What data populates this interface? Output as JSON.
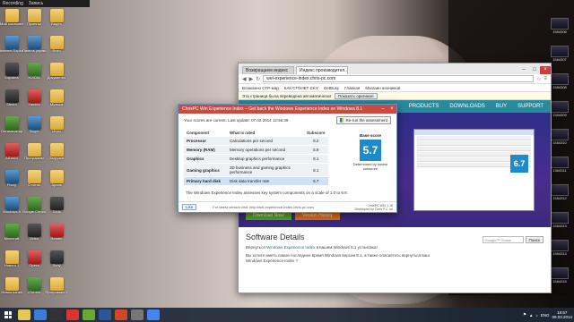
{
  "topbar": {
    "left": "Recording",
    "right": "Запись"
  },
  "desktop_left_1": [
    "Мой компьютер",
    "Internet Explorer",
    "Корзина",
    "Steam",
    "Оптимизатор",
    "AIDA64",
    "Proxy",
    "Windows 8",
    "Minecraft",
    "Нового 1",
    "Новая папка",
    "The Elder Scrolls",
    "Left 4 Dead"
  ],
  "desktop_left_2": [
    "Проекты",
    "Панель управления",
    "NVIDIA",
    "Yandex",
    "Skype",
    "Программы",
    "Отчеты",
    "Google Chrome",
    "Video",
    "Opera",
    "uTorrent",
    "Total Commander",
    "TeamViewer"
  ],
  "desktop_left_3": [
    "Видео",
    "Фото",
    "Документы",
    "Музыка",
    "Игры",
    "Загрузки",
    "Архив",
    "Tools",
    "Reader",
    "Sony",
    "Программы 2",
    "Темы",
    "Paint"
  ],
  "desktop_right": [
    "1584306",
    "1584307",
    "1584308",
    "1584309",
    "1584310",
    "1584311",
    "1584312",
    "1584313",
    "1584314",
    "1584315",
    "1584316"
  ],
  "browser": {
    "tabs": [
      "Возвращаем индекс",
      "Индекс производител..."
    ],
    "url": "wei-experience-index.chris-pc.com",
    "bookmarks": [
      "Возможно СТР-мар",
      "КАК СТОНЕТ CKY",
      "GetBusy",
      "Главная",
      "Магазин анонимов"
    ],
    "infobar_text": "Эта страница была переведена автоматически",
    "infobar_btn": "Показать оригинал",
    "site_nav": [
      "PRODUCTS",
      "DOWNLOADS",
      "BUY",
      "SUPPORT"
    ],
    "mini_score": "6.7",
    "download_btn": "Download Now!",
    "history_btn": "Version History",
    "details_title": "Software Details",
    "details_p1_prefix": "Вернуться ",
    "details_p1_link": "Windows Experience Index",
    "details_p1_suffix": " в вашем Windows 8.1 установка!",
    "details_p2": "Вы хотите иметь самое последнее время Windows версии 8.1, а также опасаетесь вернуться ваш Windows Experience Index ?",
    "search_placeholder": "Google™ Поиск",
    "search_btn": "Поиск"
  },
  "dialog": {
    "title": "ChrisPC Win Experience Index – Get back the Windows Experience Index on Windows 8.1",
    "last_update": "Your scores are current. Last update: 07.02.2014 12:56:39",
    "rerun": "Re-run the assessment",
    "headers": {
      "component": "Component",
      "rated": "What is rated",
      "subscore": "Subscore",
      "base": "Base score"
    },
    "rows": [
      {
        "component": "Processor",
        "rated": "Calculations per second",
        "subscore": "8.2"
      },
      {
        "component": "Memory (RAM)",
        "rated": "Memory operations per second",
        "subscore": "5.9"
      },
      {
        "component": "Graphics",
        "rated": "Desktop graphics performance",
        "subscore": "8.1"
      },
      {
        "component": "Gaming graphics",
        "rated": "3D business and gaming graphics performance",
        "subscore": "8.1"
      },
      {
        "component": "Primary hard disk",
        "rated": "Disk data transfer rate",
        "subscore": "5.7"
      }
    ],
    "base_score": "5.7",
    "base_caption": "Determined by lowest subscore",
    "note": "The Windows Experience Index assesses key system components on a scale of 1.0 to 9.9.",
    "like": "Like",
    "foot_link": "For latest version visit: http://win-experience-index.chris-pc.com",
    "version": "ChrisPC WEI 1.18",
    "copyright": "Developed by Chris P.C. srl"
  },
  "taskbar": {
    "apps": [
      "explorer",
      "ie",
      "steam",
      "yandex",
      "utorrent",
      "word",
      "office",
      "video",
      "chrome"
    ],
    "lang": "ENG",
    "time": "16:57",
    "date": "09.03.2014"
  }
}
